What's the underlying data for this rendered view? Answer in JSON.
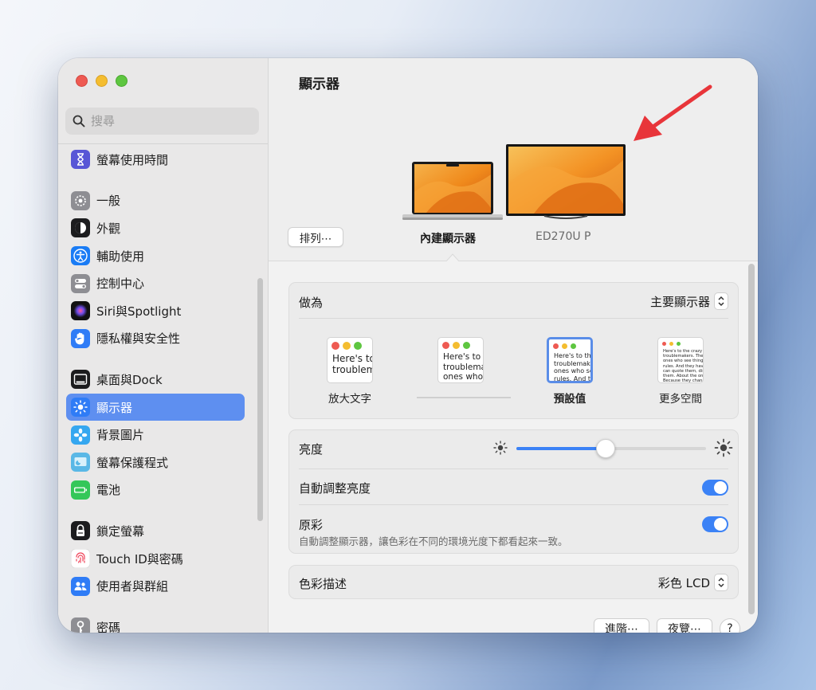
{
  "search": {
    "placeholder": "搜尋"
  },
  "sidebar": {
    "items": [
      {
        "label": "螢幕使用時間",
        "icon": "hourglass-icon",
        "color": "#5856d6",
        "group": 0
      },
      {
        "label": "一般",
        "icon": "gear-icon",
        "color": "#8e8e93",
        "group": 1
      },
      {
        "label": "外觀",
        "icon": "appearance-icon",
        "color": "#1c1c1e",
        "group": 1
      },
      {
        "label": "輔助使用",
        "icon": "accessibility-icon",
        "color": "#1a7cf5",
        "group": 1
      },
      {
        "label": "控制中心",
        "icon": "control-center-icon",
        "color": "#8e8e93",
        "group": 1
      },
      {
        "label": "Siri與Spotlight",
        "icon": "siri-icon",
        "color": "#7b4be0",
        "group": 1
      },
      {
        "label": "隱私權與安全性",
        "icon": "hand-icon",
        "color": "#2f7cf6",
        "group": 1
      },
      {
        "label": "桌面與Dock",
        "icon": "dock-icon",
        "color": "#1c1c1e",
        "group": 2
      },
      {
        "label": "顯示器",
        "icon": "brightness-icon",
        "color": "#2f7cf6",
        "group": 2,
        "active": true
      },
      {
        "label": "背景圖片",
        "icon": "wallpaper-icon",
        "color": "#35a7f0",
        "group": 2
      },
      {
        "label": "螢幕保護程式",
        "icon": "screensaver-icon",
        "color": "#5ab8e6",
        "group": 2
      },
      {
        "label": "電池",
        "icon": "battery-icon",
        "color": "#34c759",
        "group": 2
      },
      {
        "label": "鎖定螢幕",
        "icon": "lock-icon",
        "color": "#1c1c1e",
        "group": 3
      },
      {
        "label": "Touch ID與密碼",
        "icon": "fingerprint-icon",
        "color": "#f2f2f2",
        "group": 3
      },
      {
        "label": "使用者與群組",
        "icon": "users-icon",
        "color": "#2f7cf6",
        "group": 3
      },
      {
        "label": "密碼",
        "icon": "key-icon",
        "color": "#8e8e93",
        "group": 4
      }
    ]
  },
  "main": {
    "title": "顯示器",
    "arrange_label": "排列⋯",
    "displays": {
      "builtin": "內建顯示器",
      "external": "ED270U P"
    },
    "use_as": {
      "label": "做為",
      "value": "主要顯示器"
    },
    "resolutions": [
      {
        "label": "放大文字",
        "sample": [
          "Here's to",
          "troublem"
        ],
        "selected": false
      },
      {
        "label": "",
        "sample": [
          "Here's to t",
          "troublema",
          "ones who"
        ],
        "selected": false
      },
      {
        "label": "預設值",
        "sample": [
          "Here's to the cr",
          "troublemakers.",
          "ones who see t",
          "rules. And they"
        ],
        "selected": true
      },
      {
        "label": "更多空間",
        "sample": [
          "Here's to the crazy ones",
          "troublemakers. The roun",
          "ones who see things diff",
          "rules. And they have no",
          "can quote them, disagre",
          "them. About the only thi",
          "Because they change th"
        ],
        "selected": false
      }
    ],
    "brightness": {
      "label": "亮度",
      "level": 0.47
    },
    "auto_brightness": {
      "label": "自動調整亮度",
      "on": true
    },
    "true_tone": {
      "label": "原彩",
      "description": "自動調整顯示器，讓色彩在不同的環境光度下都看起來一致。",
      "on": true
    },
    "color_profile": {
      "label": "色彩描述",
      "value": "彩色 LCD"
    },
    "buttons": {
      "advanced": "進階⋯",
      "night_shift": "夜覽⋯",
      "help": "?"
    },
    "accent_color": "#3b82f6"
  }
}
